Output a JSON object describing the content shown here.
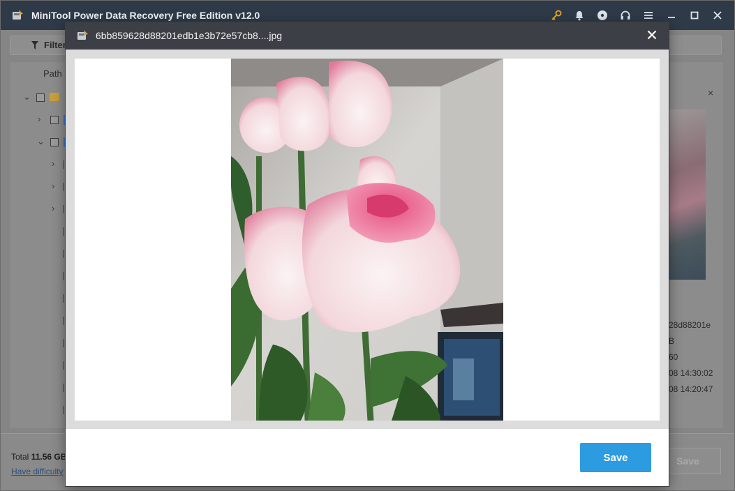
{
  "app": {
    "title": "MiniTool Power Data Recovery Free Edition v12.0",
    "toolbar_icons": [
      "key-icon",
      "bell-icon",
      "disc-icon",
      "headset-icon",
      "menu-icon",
      "minimize-icon",
      "maximize-icon",
      "close-icon"
    ],
    "filter_label": "Filter",
    "path_header": "Path",
    "total_label": "Total ",
    "total_value": "11.56 GB",
    "help_link": "Have difficulty",
    "save_label": "Save"
  },
  "details": {
    "name_fragment": "28d88201e",
    "size_fragment": "B",
    "dimension_fragment": "60",
    "created_fragment": "08 14:30:02",
    "modified_fragment": "08 14:20:47"
  },
  "dialog": {
    "title": "6bb859628d88201edb1e3b72e57cb8....jpg",
    "save_label": "Save"
  },
  "colors": {
    "titlebar": "#2e3a48",
    "dialog_header": "#3c3f46",
    "accent": "#2d9be0",
    "key_icon": "#e0a12b"
  }
}
